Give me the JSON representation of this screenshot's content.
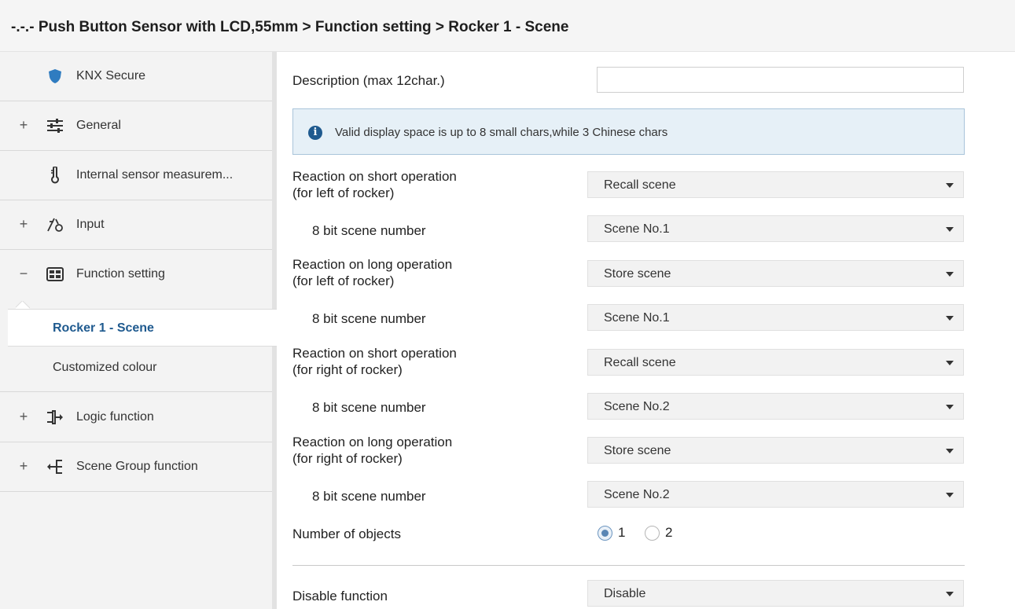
{
  "breadcrumb": "-.-.- Push Button Sensor with LCD,55mm > Function setting > Rocker 1 - Scene",
  "sidebar": {
    "items": [
      {
        "label": "KNX Secure",
        "expander": "",
        "icon": "shield-icon"
      },
      {
        "label": "General",
        "expander": "+",
        "icon": "sliders-icon"
      },
      {
        "label": "Internal sensor measurem...",
        "expander": "",
        "icon": "thermometer-icon"
      },
      {
        "label": "Input",
        "expander": "+",
        "icon": "input-icon"
      },
      {
        "label": "Function setting",
        "expander": "−",
        "icon": "grid-icon"
      },
      {
        "label": "Logic function",
        "expander": "+",
        "icon": "logic-icon"
      },
      {
        "label": "Scene Group function",
        "expander": "+",
        "icon": "scene-group-icon"
      }
    ],
    "subitems": [
      {
        "label": "Rocker 1 - Scene",
        "active": true
      },
      {
        "label": "Customized colour",
        "active": false
      }
    ]
  },
  "main": {
    "description_label": "Description (max 12char.)",
    "description_value": "",
    "info_text": "Valid display space is up to 8 small chars,while 3 Chinese chars",
    "rows": [
      {
        "label_line1": "Reaction on short operation",
        "label_line2": "(for left of rocker)",
        "value": "Recall scene"
      },
      {
        "label_line1": "8 bit scene number",
        "value": "Scene No.1"
      },
      {
        "label_line1": "Reaction on long operation",
        "label_line2": "(for left of rocker)",
        "value": "Store scene"
      },
      {
        "label_line1": "8 bit scene number",
        "value": "Scene No.1"
      },
      {
        "label_line1": "Reaction on short operation",
        "label_line2": "(for right of rocker)",
        "value": "Recall scene"
      },
      {
        "label_line1": "8 bit scene number",
        "value": "Scene No.2"
      },
      {
        "label_line1": "Reaction on long operation",
        "label_line2": "(for right of rocker)",
        "value": "Store scene"
      },
      {
        "label_line1": "8 bit scene number",
        "value": "Scene No.2"
      }
    ],
    "objects_label": "Number of objects",
    "objects_options": [
      "1",
      "2"
    ],
    "objects_selected": "1",
    "disable_label": "Disable function",
    "disable_value": "Disable"
  },
  "colors": {
    "accent": "#1f5a8f",
    "info_bg": "#e6f0f7",
    "sidebar_bg": "#f3f3f3"
  }
}
